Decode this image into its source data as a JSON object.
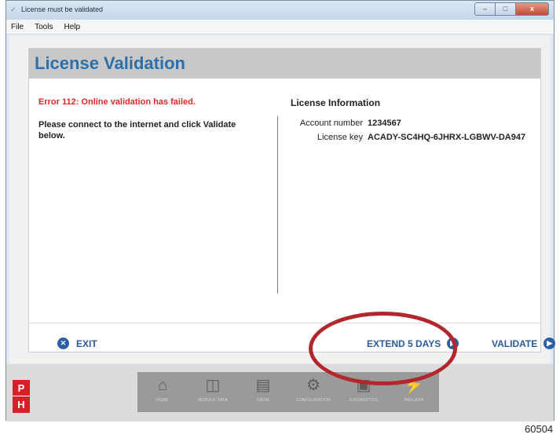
{
  "window": {
    "title": "License must be validated",
    "controls": {
      "minimize": "–",
      "maximize": "□",
      "close": "x"
    }
  },
  "menu": [
    "File",
    "Tools",
    "Help"
  ],
  "panel": {
    "title": "License Validation",
    "error": "Error 112: Online validation has failed.",
    "instructions": "Please connect to the internet and click Validate below.",
    "license_info": {
      "title": "License Information",
      "account_label": "Account number",
      "account_value": "1234567",
      "key_label": "License key",
      "key_value": "ACADY-SC4HQ-6JHRX-LGBWV-DA947"
    }
  },
  "actions": {
    "exit": "EXIT",
    "extend": "EXTEND 5 DAYS",
    "validate": "VALIDATE"
  },
  "colors": {
    "accent": "#2c6fa9",
    "error": "#e0282c",
    "highlight": "#b3262d",
    "brand_red": "#d42128"
  },
  "brand": {
    "top": "P",
    "bottom": "H"
  },
  "nav": [
    {
      "label": "HOME",
      "icon": "home-icon"
    },
    {
      "label": "MODULE DATA",
      "icon": "module-data-icon"
    },
    {
      "label": "EBOM",
      "icon": "ebom-icon"
    },
    {
      "label": "CONFIGURATION",
      "icon": "configuration-icon"
    },
    {
      "label": "DIAGNOSTICS",
      "icon": "diagnostics-icon"
    },
    {
      "label": "REFLASH",
      "icon": "reflash-icon"
    }
  ],
  "figure_number": "60504"
}
